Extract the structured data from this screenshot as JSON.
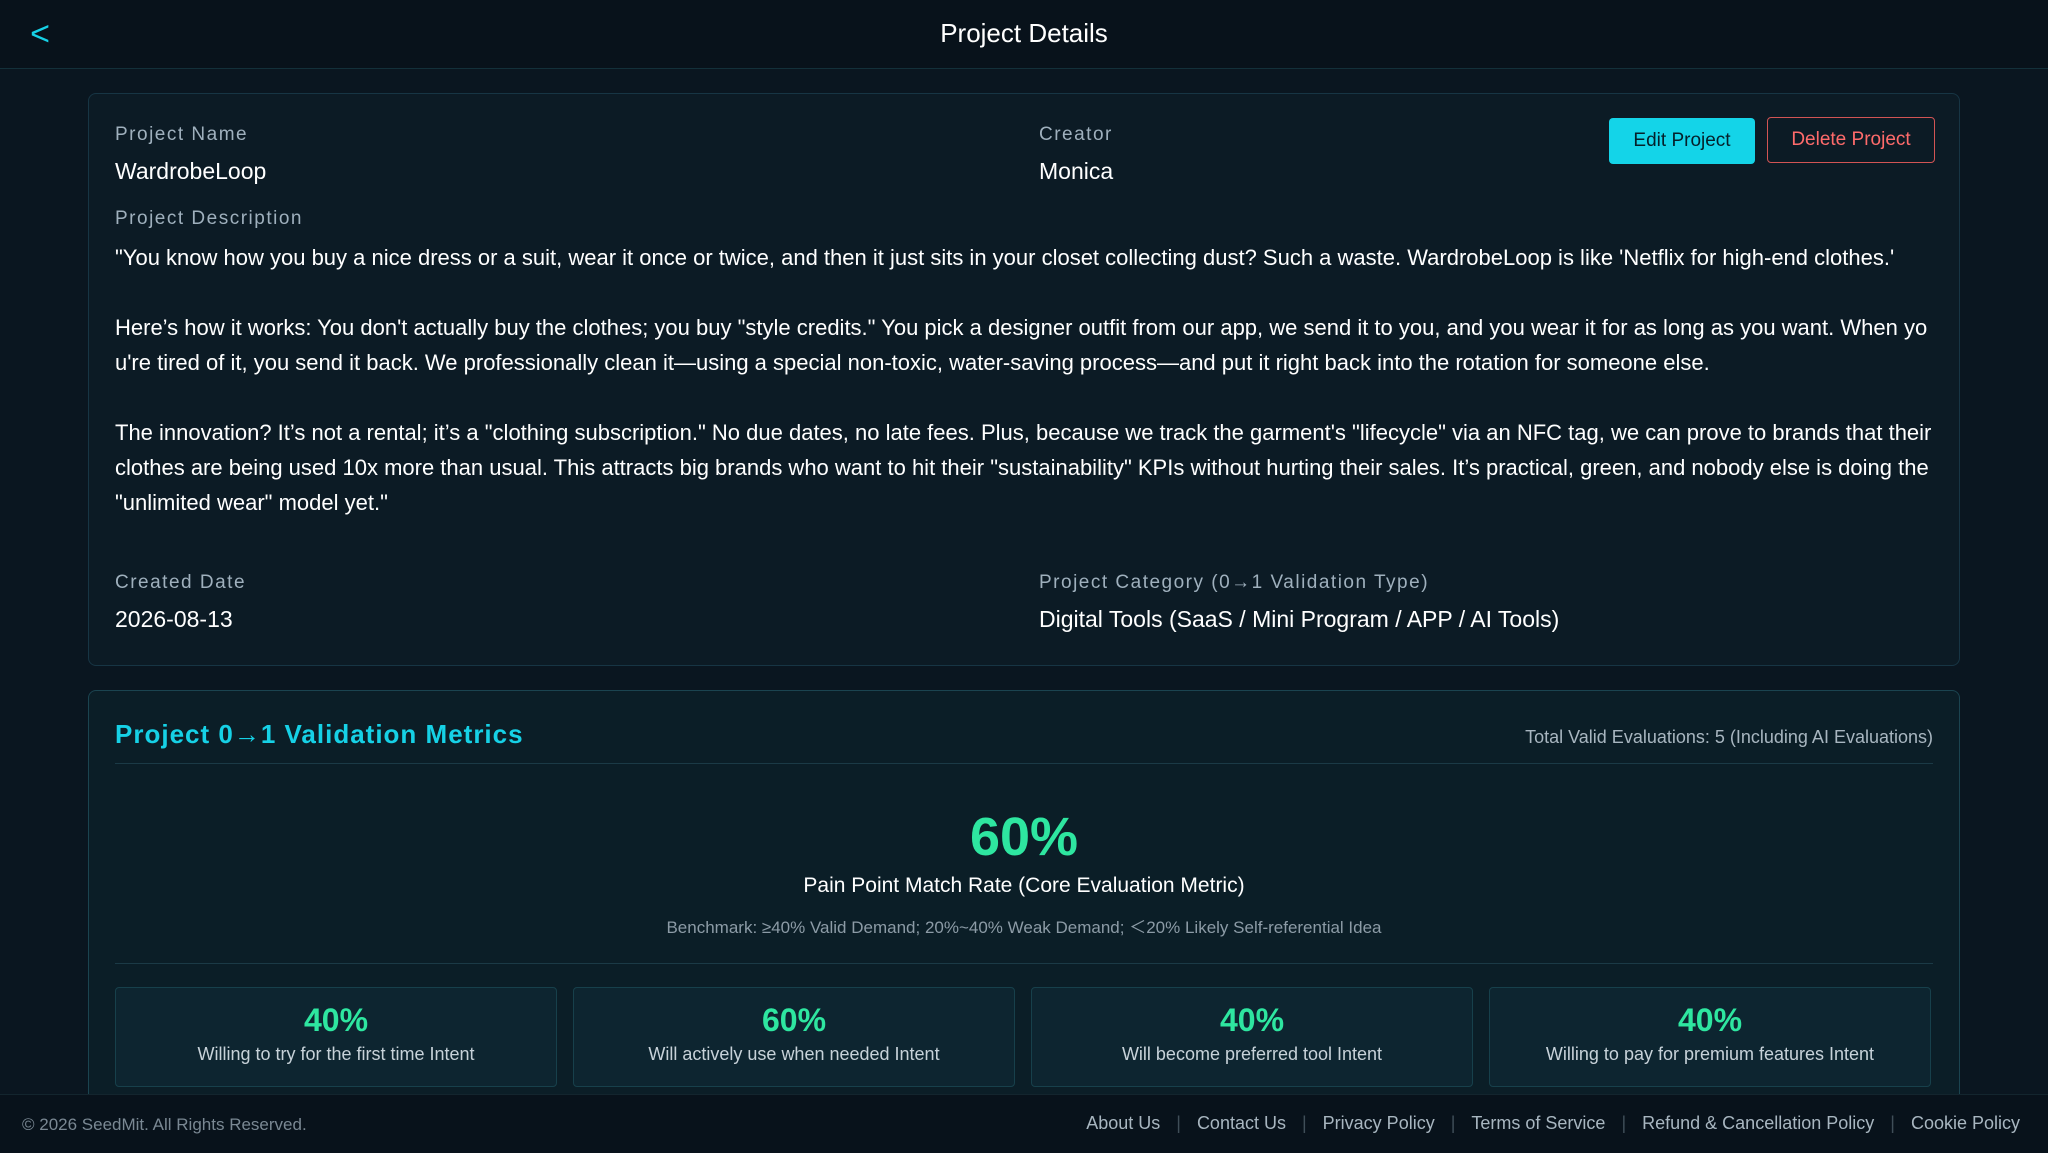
{
  "header": {
    "back_label": "<",
    "title": "Project Details"
  },
  "project": {
    "name_label": "Project Name",
    "name": "WardrobeLoop",
    "creator_label": "Creator",
    "creator": "Monica",
    "edit_label": "Edit Project",
    "delete_label": "Delete Project",
    "description_label": "Project Description",
    "description": [
      "\"You know how you buy a nice dress or a suit, wear it once or twice, and then it just sits in your closet collecting dust? Such a waste. WardrobeLoop is like 'Netflix for high-end clothes.'",
      "Here’s how it works: You don't actually buy the clothes; you buy \"style credits.\" You pick a designer outfit from our app, we send it to you, and you wear it for as long as you want. When you're tired of it, you send it back. We professionally clean it—using a special non-toxic, water-saving process—and put it right back into the rotation for someone else.",
      "The innovation? It’s not a rental; it’s a \"clothing subscription.\" No due dates, no late fees. Plus, because we track the garment's \"lifecycle\" via an NFC tag, we can prove to brands that their clothes are being used 10x more than usual. This attracts big brands who want to hit their \"sustainability\" KPIs without hurting their sales. It’s practical, green, and nobody else is doing the \"unlimited wear\" model yet.\""
    ],
    "created_label": "Created Date",
    "created": "2026-08-13",
    "category_label": "Project Category (0→1 Validation Type)",
    "category": "Digital Tools (SaaS / Mini Program / APP / AI Tools)"
  },
  "metrics": {
    "title": "Project 0→1 Validation Metrics",
    "total": "Total Valid Evaluations: 5 (Including AI Evaluations)",
    "core_value": "60%",
    "core_label": "Pain Point Match Rate (Core Evaluation Metric)",
    "benchmark": "Benchmark: ≥40% Valid Demand; 20%~40% Weak Demand; ＜20% Likely Self-referential Idea",
    "items": [
      {
        "value": "40%",
        "label": "Willing to try for the first time Intent"
      },
      {
        "value": "60%",
        "label": "Will actively use when needed Intent"
      },
      {
        "value": "40%",
        "label": "Will become preferred tool Intent"
      },
      {
        "value": "40%",
        "label": "Willing to pay for premium features Intent"
      }
    ]
  },
  "footer": {
    "copyright": "© 2026 SeedMit. All Rights Reserved.",
    "links": [
      "About Us",
      "Contact Us",
      "Privacy Policy",
      "Terms of Service",
      "Refund & Cancellation Policy",
      "Cookie Policy"
    ]
  },
  "colors": {
    "accent": "#16d1e6",
    "positive": "#2ee6a0",
    "danger": "#ff6b6b",
    "background": "#0a1620"
  }
}
